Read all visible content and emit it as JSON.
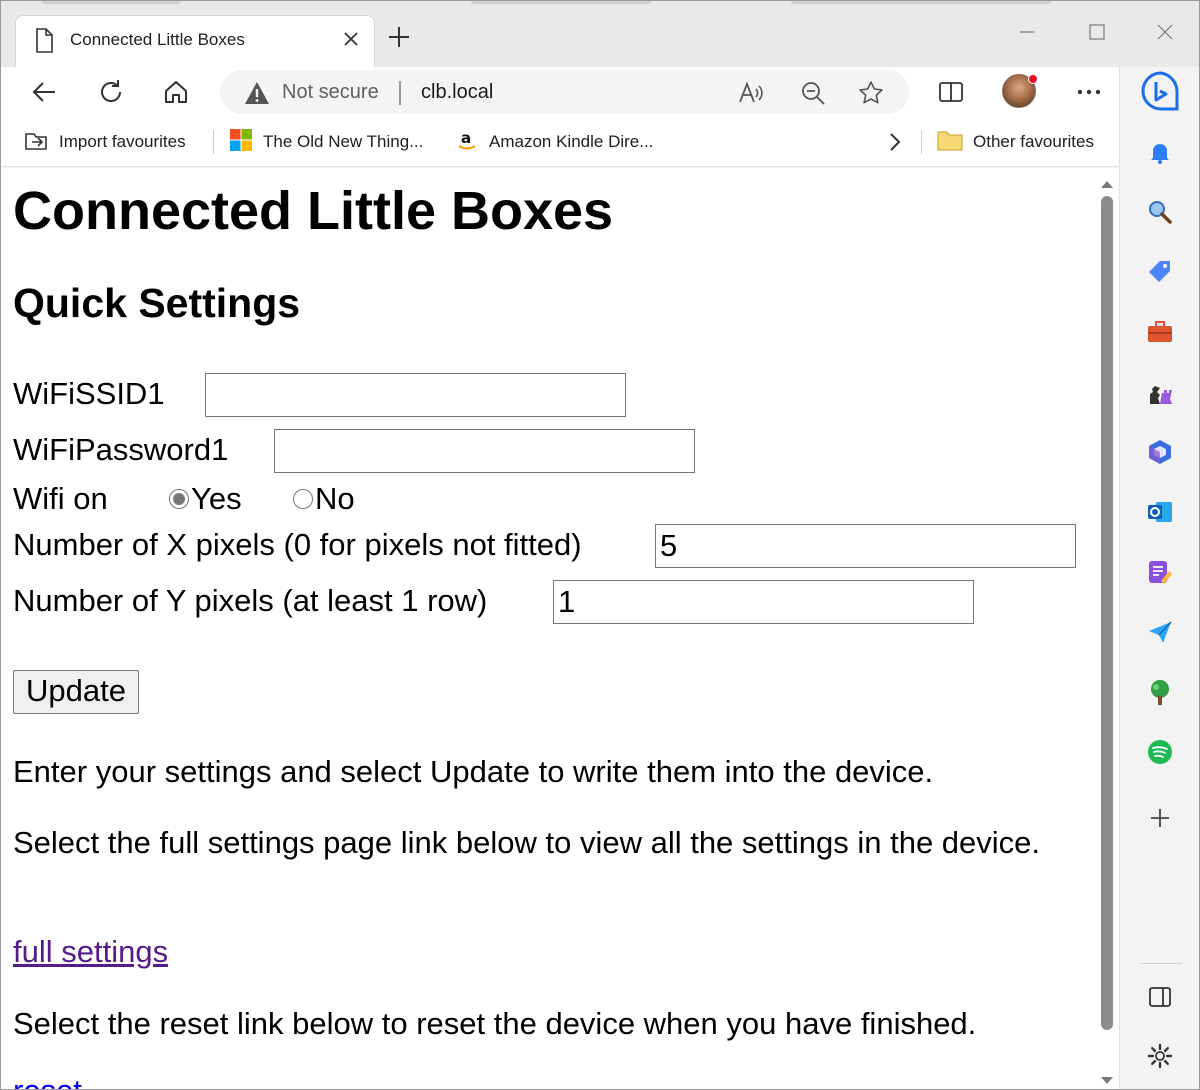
{
  "browser": {
    "tab": {
      "title": "Connected Little Boxes"
    },
    "address": {
      "security_text": "Not secure",
      "url": "clb.local"
    },
    "favourites": [
      {
        "label": "Import favourites"
      },
      {
        "label": "The Old New Thing..."
      },
      {
        "label": "Amazon Kindle Dire..."
      }
    ],
    "other_favourites": "Other favourites",
    "colors": {
      "accent": "#0c59d6",
      "tab_bg": "#ffffff",
      "strip_bg": "#e9e9e9",
      "link_visited": "#551a8b"
    }
  },
  "page": {
    "title": "Connected Little Boxes",
    "subtitle": "Quick Settings",
    "fields": {
      "ssid_label": "WiFiSSID1",
      "ssid_value": "",
      "password_label": "WiFiPassword1",
      "password_value": "",
      "wifi_label": "Wifi on",
      "wifi_yes": "Yes",
      "wifi_no": "No",
      "xpixels_label": "Number of X pixels (0 for pixels not fitted)",
      "xpixels_value": "5",
      "ypixels_label": "Number of Y pixels (at least 1 row)",
      "ypixels_value": "1"
    },
    "update_button": "Update",
    "para1": "Enter your settings and select Update to write them into the device.",
    "para2": "Select the full settings page link below to view all the settings in the device.",
    "full_settings_link": "full settings",
    "para3": "Select the reset link below to reset the device when you have finished.",
    "reset_link": "reset"
  }
}
